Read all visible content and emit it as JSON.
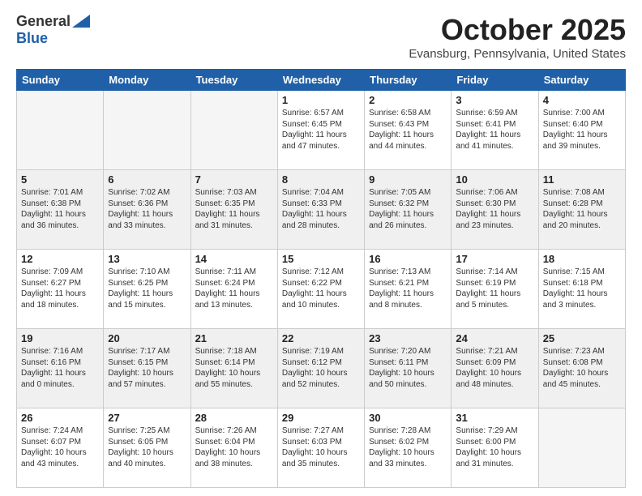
{
  "header": {
    "logo_general": "General",
    "logo_blue": "Blue",
    "month_title": "October 2025",
    "location": "Evansburg, Pennsylvania, United States"
  },
  "days_of_week": [
    "Sunday",
    "Monday",
    "Tuesday",
    "Wednesday",
    "Thursday",
    "Friday",
    "Saturday"
  ],
  "weeks": [
    [
      {
        "day": "",
        "info": ""
      },
      {
        "day": "",
        "info": ""
      },
      {
        "day": "",
        "info": ""
      },
      {
        "day": "1",
        "info": "Sunrise: 6:57 AM\nSunset: 6:45 PM\nDaylight: 11 hours\nand 47 minutes."
      },
      {
        "day": "2",
        "info": "Sunrise: 6:58 AM\nSunset: 6:43 PM\nDaylight: 11 hours\nand 44 minutes."
      },
      {
        "day": "3",
        "info": "Sunrise: 6:59 AM\nSunset: 6:41 PM\nDaylight: 11 hours\nand 41 minutes."
      },
      {
        "day": "4",
        "info": "Sunrise: 7:00 AM\nSunset: 6:40 PM\nDaylight: 11 hours\nand 39 minutes."
      }
    ],
    [
      {
        "day": "5",
        "info": "Sunrise: 7:01 AM\nSunset: 6:38 PM\nDaylight: 11 hours\nand 36 minutes."
      },
      {
        "day": "6",
        "info": "Sunrise: 7:02 AM\nSunset: 6:36 PM\nDaylight: 11 hours\nand 33 minutes."
      },
      {
        "day": "7",
        "info": "Sunrise: 7:03 AM\nSunset: 6:35 PM\nDaylight: 11 hours\nand 31 minutes."
      },
      {
        "day": "8",
        "info": "Sunrise: 7:04 AM\nSunset: 6:33 PM\nDaylight: 11 hours\nand 28 minutes."
      },
      {
        "day": "9",
        "info": "Sunrise: 7:05 AM\nSunset: 6:32 PM\nDaylight: 11 hours\nand 26 minutes."
      },
      {
        "day": "10",
        "info": "Sunrise: 7:06 AM\nSunset: 6:30 PM\nDaylight: 11 hours\nand 23 minutes."
      },
      {
        "day": "11",
        "info": "Sunrise: 7:08 AM\nSunset: 6:28 PM\nDaylight: 11 hours\nand 20 minutes."
      }
    ],
    [
      {
        "day": "12",
        "info": "Sunrise: 7:09 AM\nSunset: 6:27 PM\nDaylight: 11 hours\nand 18 minutes."
      },
      {
        "day": "13",
        "info": "Sunrise: 7:10 AM\nSunset: 6:25 PM\nDaylight: 11 hours\nand 15 minutes."
      },
      {
        "day": "14",
        "info": "Sunrise: 7:11 AM\nSunset: 6:24 PM\nDaylight: 11 hours\nand 13 minutes."
      },
      {
        "day": "15",
        "info": "Sunrise: 7:12 AM\nSunset: 6:22 PM\nDaylight: 11 hours\nand 10 minutes."
      },
      {
        "day": "16",
        "info": "Sunrise: 7:13 AM\nSunset: 6:21 PM\nDaylight: 11 hours\nand 8 minutes."
      },
      {
        "day": "17",
        "info": "Sunrise: 7:14 AM\nSunset: 6:19 PM\nDaylight: 11 hours\nand 5 minutes."
      },
      {
        "day": "18",
        "info": "Sunrise: 7:15 AM\nSunset: 6:18 PM\nDaylight: 11 hours\nand 3 minutes."
      }
    ],
    [
      {
        "day": "19",
        "info": "Sunrise: 7:16 AM\nSunset: 6:16 PM\nDaylight: 11 hours\nand 0 minutes."
      },
      {
        "day": "20",
        "info": "Sunrise: 7:17 AM\nSunset: 6:15 PM\nDaylight: 10 hours\nand 57 minutes."
      },
      {
        "day": "21",
        "info": "Sunrise: 7:18 AM\nSunset: 6:14 PM\nDaylight: 10 hours\nand 55 minutes."
      },
      {
        "day": "22",
        "info": "Sunrise: 7:19 AM\nSunset: 6:12 PM\nDaylight: 10 hours\nand 52 minutes."
      },
      {
        "day": "23",
        "info": "Sunrise: 7:20 AM\nSunset: 6:11 PM\nDaylight: 10 hours\nand 50 minutes."
      },
      {
        "day": "24",
        "info": "Sunrise: 7:21 AM\nSunset: 6:09 PM\nDaylight: 10 hours\nand 48 minutes."
      },
      {
        "day": "25",
        "info": "Sunrise: 7:23 AM\nSunset: 6:08 PM\nDaylight: 10 hours\nand 45 minutes."
      }
    ],
    [
      {
        "day": "26",
        "info": "Sunrise: 7:24 AM\nSunset: 6:07 PM\nDaylight: 10 hours\nand 43 minutes."
      },
      {
        "day": "27",
        "info": "Sunrise: 7:25 AM\nSunset: 6:05 PM\nDaylight: 10 hours\nand 40 minutes."
      },
      {
        "day": "28",
        "info": "Sunrise: 7:26 AM\nSunset: 6:04 PM\nDaylight: 10 hours\nand 38 minutes."
      },
      {
        "day": "29",
        "info": "Sunrise: 7:27 AM\nSunset: 6:03 PM\nDaylight: 10 hours\nand 35 minutes."
      },
      {
        "day": "30",
        "info": "Sunrise: 7:28 AM\nSunset: 6:02 PM\nDaylight: 10 hours\nand 33 minutes."
      },
      {
        "day": "31",
        "info": "Sunrise: 7:29 AM\nSunset: 6:00 PM\nDaylight: 10 hours\nand 31 minutes."
      },
      {
        "day": "",
        "info": ""
      }
    ]
  ]
}
